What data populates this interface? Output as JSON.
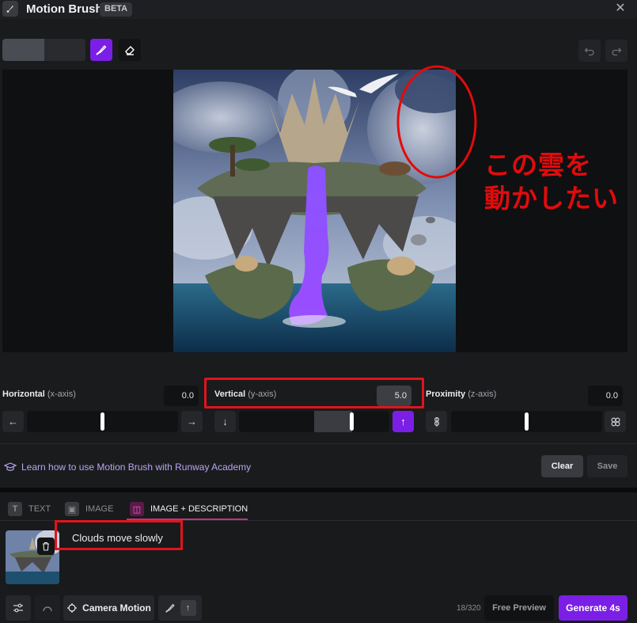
{
  "header": {
    "title": "Motion Brush",
    "badge": "BETA",
    "close_icon": "close-icon"
  },
  "toolbar": {
    "brush_size_fraction": 0.5,
    "brush_icon": "brush-icon",
    "eraser_icon": "eraser-icon",
    "undo_icon": "undo-icon",
    "redo_icon": "redo-icon"
  },
  "annotation": {
    "text_line1": "この雲を",
    "text_line2": "動かしたい",
    "color": "#e20b0b"
  },
  "axes": {
    "horizontal": {
      "label": "Horizontal",
      "sub": "(x-axis)",
      "value": "0.0",
      "slider_level": 0.5
    },
    "vertical": {
      "label": "Vertical",
      "sub": "(y-axis)",
      "value": "5.0",
      "slider_level": 0.75
    },
    "proximity": {
      "label": "Proximity",
      "sub": "(z-axis)",
      "value": "0.0",
      "slider_level": 0.5
    }
  },
  "footer": {
    "academy_link": "Learn how to use Motion Brush with Runway Academy",
    "clear_label": "Clear",
    "save_label": "Save"
  },
  "tabs": [
    {
      "label": "TEXT",
      "icon_glyph": "T"
    },
    {
      "label": "IMAGE",
      "icon_glyph": "▣"
    },
    {
      "label": "IMAGE + DESCRIPTION",
      "icon_glyph": "◫",
      "active": true
    }
  ],
  "prompt": {
    "text": "Clouds move slowly"
  },
  "bottom_bar": {
    "camera_motion_label": "Camera Motion",
    "char_count": "18/320",
    "free_preview_label": "Free Preview",
    "generate_label": "Generate 4s"
  },
  "colors": {
    "accent": "#7b1fe6",
    "highlight": "#e0141a",
    "active_tab": "#c0337f"
  }
}
